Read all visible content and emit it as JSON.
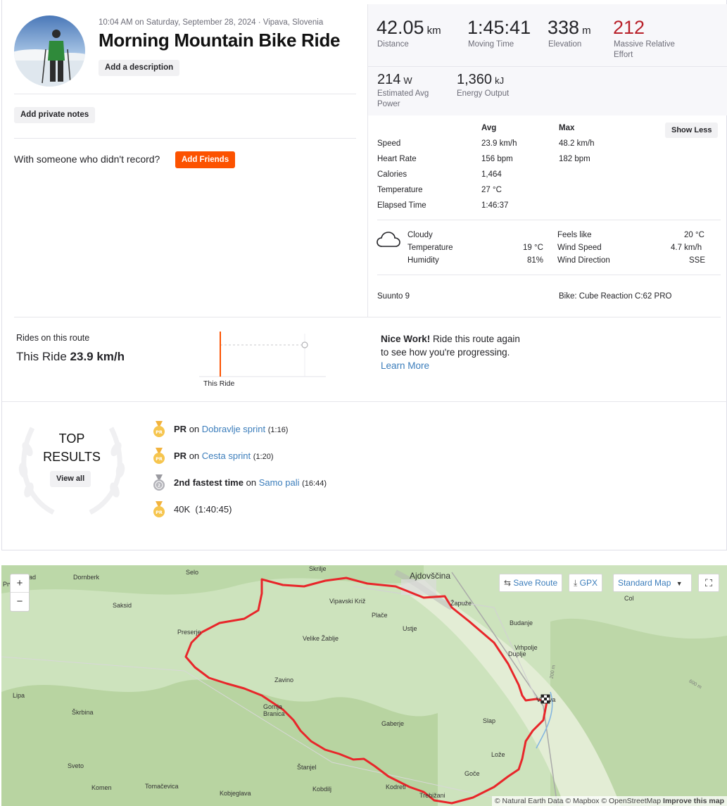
{
  "activity": {
    "datetime": "10:04 AM on Saturday, September 28, 2024 · Vipava, Slovenia",
    "title": "Morning Mountain Bike Ride",
    "add_description": "Add a description",
    "add_private_notes": "Add private notes",
    "with_someone": "With someone who didn't record?",
    "add_friends": "Add Friends"
  },
  "stats": {
    "distance": {
      "value": "42.05",
      "unit": "km",
      "label": "Distance"
    },
    "moving_time": {
      "value": "1:45:41",
      "label": "Moving Time"
    },
    "elevation": {
      "value": "338",
      "unit": "m",
      "label": "Elevation"
    },
    "relative_effort": {
      "value": "212",
      "label": "Massive Relative Effort"
    },
    "power": {
      "value": "214",
      "unit": "W",
      "label": "Estimated Avg Power"
    },
    "energy": {
      "value": "1,360",
      "unit": "kJ",
      "label": "Energy Output"
    }
  },
  "details": {
    "col_avg": "Avg",
    "col_max": "Max",
    "show_less": "Show Less",
    "rows": [
      {
        "label": "Speed",
        "avg": "23.9 km/h",
        "max": "48.2 km/h"
      },
      {
        "label": "Heart Rate",
        "avg": "156 bpm",
        "max": "182 bpm"
      },
      {
        "label": "Calories",
        "avg": "1,464",
        "max": ""
      },
      {
        "label": "Temperature",
        "avg": "27 °C",
        "max": ""
      },
      {
        "label": "Elapsed Time",
        "avg": "1:46:37",
        "max": ""
      }
    ]
  },
  "weather": {
    "icon": "cloud-icon",
    "condition": "Cloudy",
    "temperature_label": "Temperature",
    "temperature": "19 °C",
    "humidity_label": "Humidity",
    "humidity": "81%",
    "feels_like_label": "Feels like",
    "feels_like": "20 °C",
    "wind_speed_label": "Wind Speed",
    "wind_speed": "4.7 km/h",
    "wind_direction_label": "Wind Direction",
    "wind_direction": "SSE"
  },
  "gear": {
    "device": "Suunto 9",
    "bike": "Bike: Cube Reaction C:62 PRO"
  },
  "route": {
    "heading": "Rides on this route",
    "this_ride_prefix": "This Ride",
    "this_ride_speed": "23.9 km/h",
    "chart_label": "This Ride",
    "nice_work_bold": "Nice Work!",
    "nice_work_line1": "Ride this route again",
    "nice_work_line2": "to see how you're progressing.",
    "learn_more": "Learn More"
  },
  "top_results": {
    "title_line1": "TOP",
    "title_line2": "RESULTS",
    "view_all": "View all",
    "items": [
      {
        "icon": "pr-medal-icon",
        "prefix": "PR",
        "on": "on",
        "segment": "Dobravlje sprint",
        "time": "(1:16)"
      },
      {
        "icon": "pr-medal-icon",
        "prefix": "PR",
        "on": "on",
        "segment": "Cesta sprint",
        "time": "(1:20)"
      },
      {
        "icon": "silver-medal-icon",
        "prefix": "2nd fastest time",
        "on": "on",
        "segment": "Samo pali",
        "time": "(16:44)"
      },
      {
        "icon": "pr-medal-icon",
        "prefix": "40K",
        "on": "",
        "segment": "",
        "time": "(1:40:45)"
      }
    ]
  },
  "map": {
    "zoom_in": "+",
    "zoom_out": "−",
    "save_route": "Save Route",
    "gpx": "GPX",
    "map_type": "Standard Map",
    "attribution": "© Natural Earth Data © Mapbox © OpenStreetMap",
    "improve": "Improve this map",
    "route_color": "#e8262a",
    "places": [
      "Ajdovščina",
      "Dornberk",
      "Selo",
      "Saksid",
      "Preserje",
      "Vipavski Križ",
      "Plače",
      "Ustje",
      "Velike Žablje",
      "Žapuže",
      "Budanje",
      "Vrhpolje",
      "Duplje",
      "Col",
      "Zavino",
      "Lipa",
      "Škrbina",
      "Gornja Branica",
      "Gaberje",
      "Slap",
      "Lože",
      "Sveto",
      "Štanjel",
      "Goče",
      "Komen",
      "Tomačevica",
      "Kobjeglava",
      "Kobdilj",
      "Kodreti",
      "Trebižani",
      "Skrilje",
      "Vipava",
      "Prv",
      "rad",
      "200 m",
      "600 m"
    ]
  },
  "colors": {
    "brand": "#fc5200",
    "effort": "#b8212a",
    "link": "#3b7dbb"
  }
}
